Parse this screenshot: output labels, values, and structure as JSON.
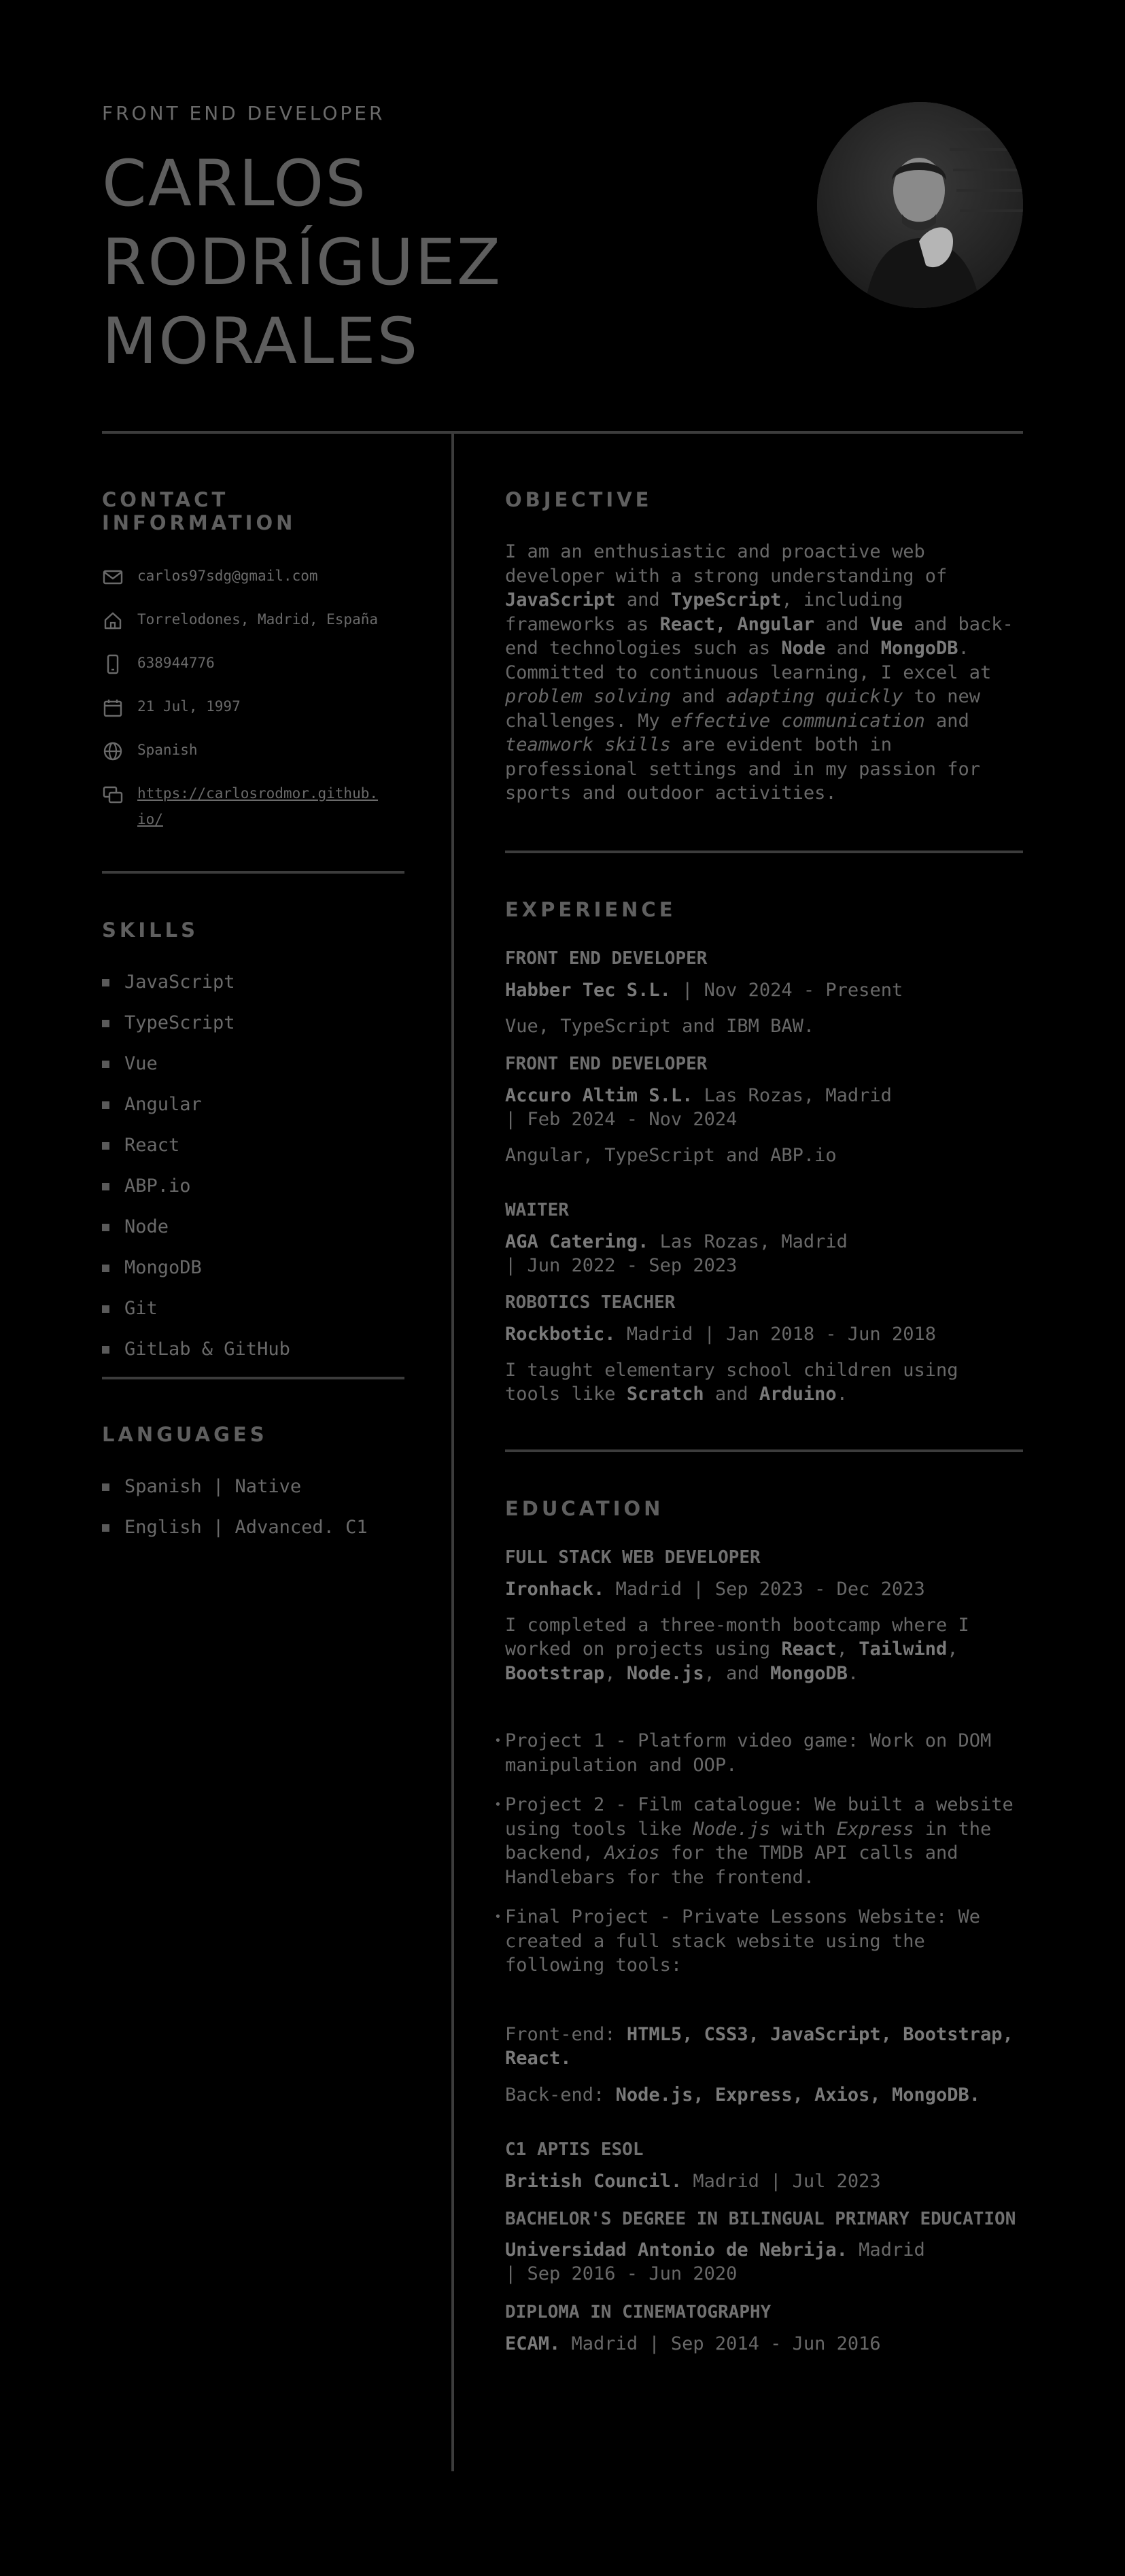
{
  "header": {
    "role": "FRONT END DEVELOPER",
    "name_lines": [
      "CARLOS",
      "RODRÍGUEZ",
      "MORALES"
    ]
  },
  "contact": {
    "title": "CONTACT INFORMATION",
    "email": "carlos97sdg@gmail.com",
    "location": "Torrelodones, Madrid, España",
    "phone": "638944776",
    "birthdate": "21 Jul, 1997",
    "nationality": "Spanish",
    "website_line1": "https://carlosrodmor.github.",
    "website_line2": "io/"
  },
  "skills": {
    "title": "SKILLS",
    "items": [
      "JavaScript",
      "TypeScript",
      "Vue",
      "Angular",
      "React",
      "ABP.io",
      "Node",
      "MongoDB",
      "Git",
      "GitLab & GitHub"
    ]
  },
  "languages": {
    "title": "LANGUAGES",
    "items": [
      "Spanish | Native",
      "English | Advanced. C1"
    ]
  },
  "objective": {
    "title": "OBJECTIVE",
    "t1": "I am an enthusiastic and proactive web developer with a strong understanding of ",
    "b1": "JavaScript",
    "t2": " and ",
    "b2": "TypeScript",
    "t3": ", including frameworks as ",
    "b3": "React, Angular",
    "t4": " and ",
    "b4": "Vue",
    "t5": " and back-end technologies such as ",
    "b5": "Node",
    "t6": " and ",
    "b6": "MongoDB",
    "t7": ". Committed to continuous learning, I excel at ",
    "i1": "problem solving",
    "t8": " and ",
    "i2": "adapting quickly",
    "t9": " to new challenges. My ",
    "i3": "effective communication",
    "t10": " and ",
    "i4": "teamwork skills",
    "t11": " are evident both in professional settings and in my passion for sports and outdoor activities."
  },
  "experience": {
    "title": "EXPERIENCE",
    "j1": {
      "title": "FRONT END DEVELOPER",
      "org": "Habber Tec S.L.",
      "meta": " | Nov 2024 - Present",
      "desc": "Vue, TypeScript and IBM BAW."
    },
    "j2": {
      "title": "FRONT END DEVELOPER",
      "org": "Accuro Altim S.L.",
      "meta1": " Las Rozas, Madrid",
      "meta2": " | Feb 2024 - Nov 2024",
      "desc": "Angular, TypeScript and ABP.io"
    },
    "j3": {
      "title": "WAITER",
      "org": "AGA Catering.",
      "meta1": " Las Rozas, Madrid",
      "meta2": " | Jun 2022 - Sep 2023"
    },
    "j4": {
      "title": "ROBOTICS TEACHER",
      "org": "Rockbotic.",
      "meta": " Madrid | Jan 2018 - Jun 2018",
      "d1": "I taught elementary school children using tools like ",
      "d2": "Scratch",
      "d3": " and ",
      "d4": "Arduino",
      "d5": "."
    }
  },
  "education": {
    "title": "EDUCATION",
    "e1": {
      "title": "FULL STACK WEB DEVELOPER",
      "org": "Ironhack.",
      "meta": " Madrid | Sep 2023 - Dec 2023",
      "d1": "I completed a three-month bootcamp where I worked on projects using ",
      "d2": "React",
      "d3": ", ",
      "d4": "Tailwind",
      "d5": ", ",
      "d6": "Bootstrap",
      "d7": ", ",
      "d8": "Node.js",
      "d9": ", and ",
      "d10": "MongoDB",
      "d11": ".",
      "p1": "Project 1 - Platform video game: Work on DOM manipulation and OOP.",
      "p2a": "Project 2 - Film catalogue: We built a website using tools like ",
      "p2b": "Node.js",
      "p2c": " with ",
      "p2d": "Express",
      "p2e": " in the backend, ",
      "p2f": "Axios",
      "p2g": " for the TMDB API calls and Handlebars for the frontend.",
      "p3": "Final Project - Private Lessons Website: We created a full stack website using the following tools:",
      "fe_label": "Front-end: ",
      "fe_tools": "HTML5, CSS3, JavaScript, Bootstrap, React.",
      "be_label": "Back-end: ",
      "be_tools": "Node.js, Express, Axios, MongoDB."
    },
    "e2": {
      "title": "C1 APTIS ESOL",
      "org": "British Council.",
      "meta": " Madrid | Jul 2023"
    },
    "e3": {
      "title": "BACHELOR'S DEGREE IN BILINGUAL PRIMARY EDUCATION",
      "org": "Universidad Antonio de Nebrija.",
      "meta1": " Madrid",
      "meta2": " | Sep 2016 - Jun 2020"
    },
    "e4": {
      "title": "DIPLOMA IN CINEMATOGRAPHY",
      "org": "ECAM.",
      "meta": " Madrid | Sep 2014 - Jun 2016"
    }
  }
}
